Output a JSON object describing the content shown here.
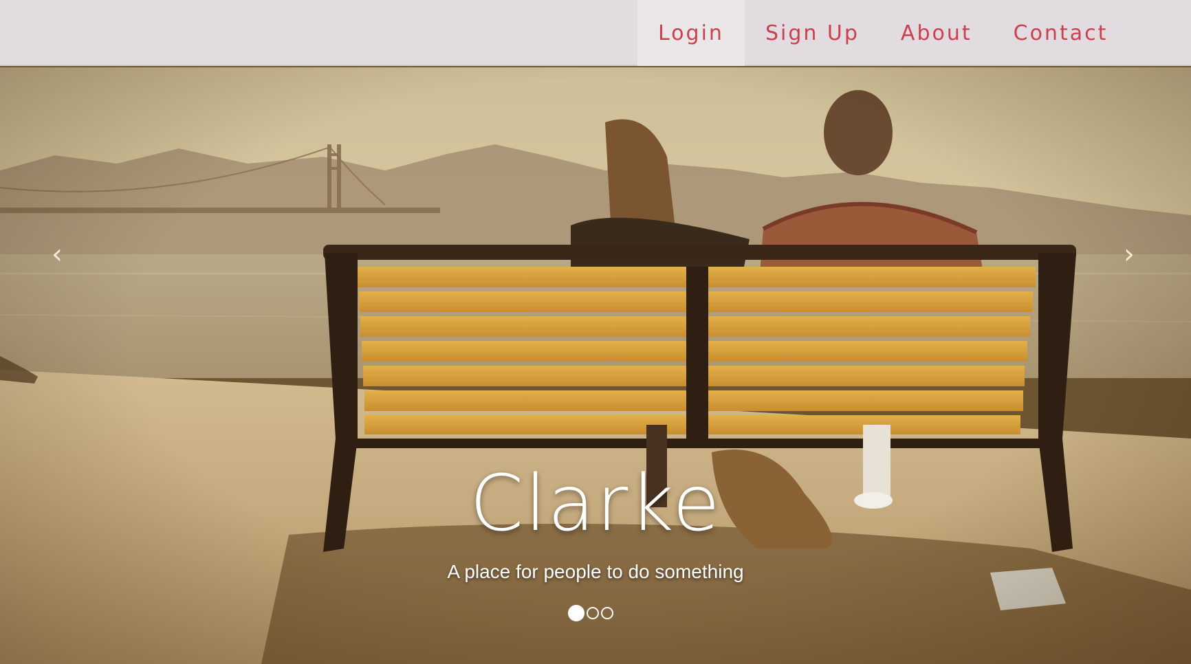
{
  "nav": {
    "items": [
      {
        "label": "Login",
        "active": true
      },
      {
        "label": "Sign Up",
        "active": false
      },
      {
        "label": "About",
        "active": false
      },
      {
        "label": "Contact",
        "active": false
      }
    ],
    "text_color": "#c9414e",
    "background": "#e2dbe0"
  },
  "hero": {
    "title": "Clarke",
    "subtitle": "A place for people to do something",
    "prev_icon": "chevron-left-icon",
    "next_icon": "chevron-right-icon",
    "prev_glyph": "‹",
    "next_glyph": "›",
    "slide_count": 3,
    "active_slide": 1,
    "image_subject": "couple-with-dog-on-bench-by-bay"
  }
}
